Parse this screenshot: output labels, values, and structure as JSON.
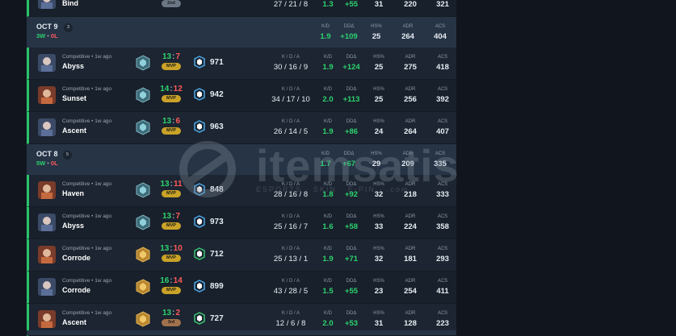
{
  "top_row": {
    "map": "Bind",
    "badge": "2nd",
    "kda": "27 / 21 / 8",
    "kd": "1.3",
    "dda": "+55",
    "hs": "31",
    "adr": "220",
    "acs": "321"
  },
  "headers": {
    "kda": "K / D / A",
    "kd": "K/D",
    "dda": "DDΔ",
    "hs": "HS%",
    "adr": "ADR",
    "acs": "ACS"
  },
  "days": [
    {
      "date": "OCT 9",
      "count": "3",
      "wins": "3",
      "win_suffix": "W",
      "losses": "0",
      "loss_suffix": "L",
      "kd": "1.9",
      "dda": "+109",
      "hs": "25",
      "adr": "264",
      "acs": "404"
    },
    {
      "date": "OCT 8",
      "count": "5",
      "wins": "5",
      "win_suffix": "W",
      "losses": "0",
      "loss_suffix": "L",
      "kd": "1.7",
      "dda": "+67",
      "hs": "29",
      "adr": "209",
      "acs": "335"
    }
  ],
  "matches": [
    {
      "meta": "Competitive • 1w ago",
      "map": "Abyss",
      "won": "13",
      "lost": "7",
      "badge": "MVP",
      "rr": "971",
      "kda": "30 / 16 / 9",
      "kd": "1.9",
      "dda": "+124",
      "hs": "25",
      "adr": "275",
      "acs": "418"
    },
    {
      "meta": "Competitive • 1w ago",
      "map": "Sunset",
      "won": "14",
      "lost": "12",
      "badge": "MVP",
      "rr": "942",
      "kda": "34 / 17 / 10",
      "kd": "2.0",
      "dda": "+113",
      "hs": "25",
      "adr": "256",
      "acs": "392"
    },
    {
      "meta": "Competitive • 1w ago",
      "map": "Ascent",
      "won": "13",
      "lost": "6",
      "badge": "MVP",
      "rr": "963",
      "kda": "26 / 14 / 5",
      "kd": "1.9",
      "dda": "+86",
      "hs": "24",
      "adr": "264",
      "acs": "407"
    },
    {
      "meta": "Competitive • 1w ago",
      "map": "Haven",
      "won": "13",
      "lost": "11",
      "badge": "MVP",
      "rr": "848",
      "kda": "28 / 16 / 8",
      "kd": "1.8",
      "dda": "+92",
      "hs": "32",
      "adr": "218",
      "acs": "333"
    },
    {
      "meta": "Competitive • 1w ago",
      "map": "Abyss",
      "won": "13",
      "lost": "7",
      "badge": "MVP",
      "rr": "973",
      "kda": "25 / 16 / 7",
      "kd": "1.6",
      "dda": "+58",
      "hs": "33",
      "adr": "224",
      "acs": "358"
    },
    {
      "meta": "Competitive • 1w ago",
      "map": "Corrode",
      "won": "13",
      "lost": "10",
      "badge": "MVP",
      "rr": "712",
      "kda": "25 / 13 / 1",
      "kd": "1.9",
      "dda": "+71",
      "hs": "32",
      "adr": "181",
      "acs": "293"
    },
    {
      "meta": "Competitive • 1w ago",
      "map": "Corrode",
      "won": "16",
      "lost": "14",
      "badge": "MVP",
      "rr": "899",
      "kda": "43 / 28 / 5",
      "kd": "1.5",
      "dda": "+55",
      "hs": "23",
      "adr": "254",
      "acs": "411"
    },
    {
      "meta": "Competitive • 1w ago",
      "map": "Ascent",
      "won": "13",
      "lost": "2",
      "badge": "3rd",
      "rr": "727",
      "kda": "12 / 6 / 8",
      "kd": "2.0",
      "dda": "+53",
      "hs": "31",
      "adr": "128",
      "acs": "223"
    }
  ],
  "watermark": {
    "text": "itemsatis",
    "sub": "ESPORTS · SKIN · E-PIN · .com"
  },
  "colors": {
    "win": "#2dd26e",
    "loss": "#ff5a5a",
    "mvp": "#c9a227",
    "row_bg": "#1c2531",
    "day_bg": "#263446"
  }
}
